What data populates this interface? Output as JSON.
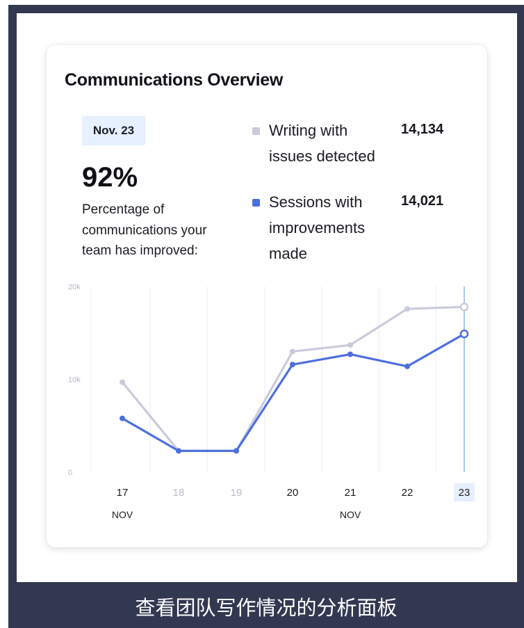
{
  "card": {
    "title": "Communications Overview",
    "date_badge": "Nov. 23",
    "percentage": "92%",
    "percentage_desc": "Percentage of communications your team has improved:"
  },
  "legend": [
    {
      "label": "Writing with issues detected",
      "value": "14,134",
      "color": "#c9cbdd"
    },
    {
      "label": "Sessions with improvements made",
      "value": "14,021",
      "color": "#4d6fe0"
    }
  ],
  "caption": "查看团队写作情况的分析面板",
  "chart_data": {
    "type": "line",
    "x": [
      "17",
      "18",
      "19",
      "20",
      "21",
      "22",
      "23"
    ],
    "x_month_labels": [
      "NOV",
      "",
      "",
      "",
      "NOV",
      "",
      ""
    ],
    "y_ticks": [
      "20k",
      "10k",
      "0"
    ],
    "ylim": [
      0,
      20000
    ],
    "highlighted_x": "23",
    "series": [
      {
        "name": "Writing with issues detected",
        "color": "#c9cbdd",
        "values": [
          9700,
          2300,
          2300,
          13000,
          13700,
          17600,
          17800
        ]
      },
      {
        "name": "Sessions with improvements made",
        "color": "#4d6fe0",
        "values": [
          5800,
          2300,
          2300,
          11600,
          12700,
          11400,
          14900
        ]
      }
    ]
  }
}
